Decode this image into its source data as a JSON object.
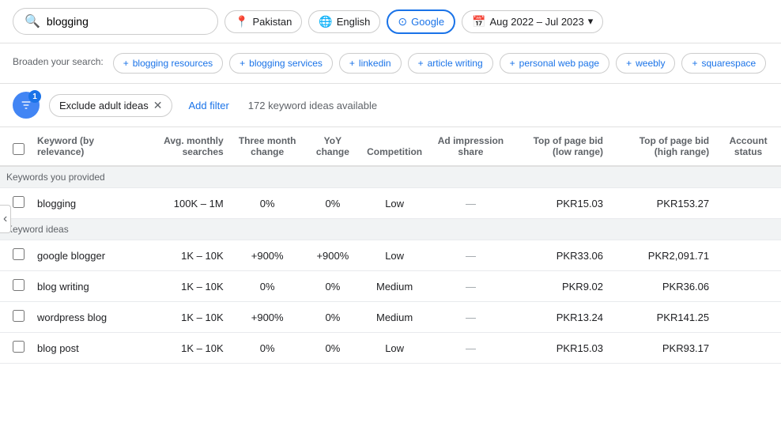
{
  "search": {
    "query": "blogging",
    "placeholder": "blogging",
    "location": "Pakistan",
    "language": "English",
    "engine": "Google",
    "date_range": "Aug 2022 – Jul 2023"
  },
  "broaden": {
    "label": "Broaden your search:",
    "chips": [
      "blogging resources",
      "blogging services",
      "linkedin",
      "article writing",
      "personal web page",
      "weebly",
      "squarespace"
    ]
  },
  "filter_bar": {
    "badge": "1",
    "exclude_label": "Exclude adult ideas",
    "add_filter": "Add filter",
    "ideas_count": "172 keyword ideas available"
  },
  "table": {
    "headers": [
      "Keyword (by relevance)",
      "Avg. monthly searches",
      "Three month change",
      "YoY change",
      "Competition",
      "Ad impression share",
      "Top of page bid (low range)",
      "Top of page bid (high range)",
      "Account status"
    ],
    "section_provided": "Keywords you provided",
    "section_ideas": "Keyword ideas",
    "rows_provided": [
      {
        "keyword": "blogging",
        "avg_monthly": "100K – 1M",
        "three_month": "0%",
        "yoy": "0%",
        "competition": "Low",
        "ad_impression": "—",
        "bid_low": "PKR15.03",
        "bid_high": "PKR153.27",
        "account_status": ""
      }
    ],
    "rows_ideas": [
      {
        "keyword": "google blogger",
        "avg_monthly": "1K – 10K",
        "three_month": "+900%",
        "yoy": "+900%",
        "competition": "Low",
        "ad_impression": "—",
        "bid_low": "PKR33.06",
        "bid_high": "PKR2,091.71",
        "account_status": ""
      },
      {
        "keyword": "blog writing",
        "avg_monthly": "1K – 10K",
        "three_month": "0%",
        "yoy": "0%",
        "competition": "Medium",
        "ad_impression": "—",
        "bid_low": "PKR9.02",
        "bid_high": "PKR36.06",
        "account_status": ""
      },
      {
        "keyword": "wordpress blog",
        "avg_monthly": "1K – 10K",
        "three_month": "+900%",
        "yoy": "0%",
        "competition": "Medium",
        "ad_impression": "—",
        "bid_low": "PKR13.24",
        "bid_high": "PKR141.25",
        "account_status": ""
      },
      {
        "keyword": "blog post",
        "avg_monthly": "1K – 10K",
        "three_month": "0%",
        "yoy": "0%",
        "competition": "Low",
        "ad_impression": "—",
        "bid_low": "PKR15.03",
        "bid_high": "PKR93.17",
        "account_status": ""
      }
    ]
  },
  "icons": {
    "search": "🔍",
    "location": "📍",
    "language": "🌐",
    "engine": "⊙",
    "calendar": "📅",
    "filter": "⚙",
    "close": "✕",
    "plus": "+",
    "chevron_left": "‹"
  }
}
